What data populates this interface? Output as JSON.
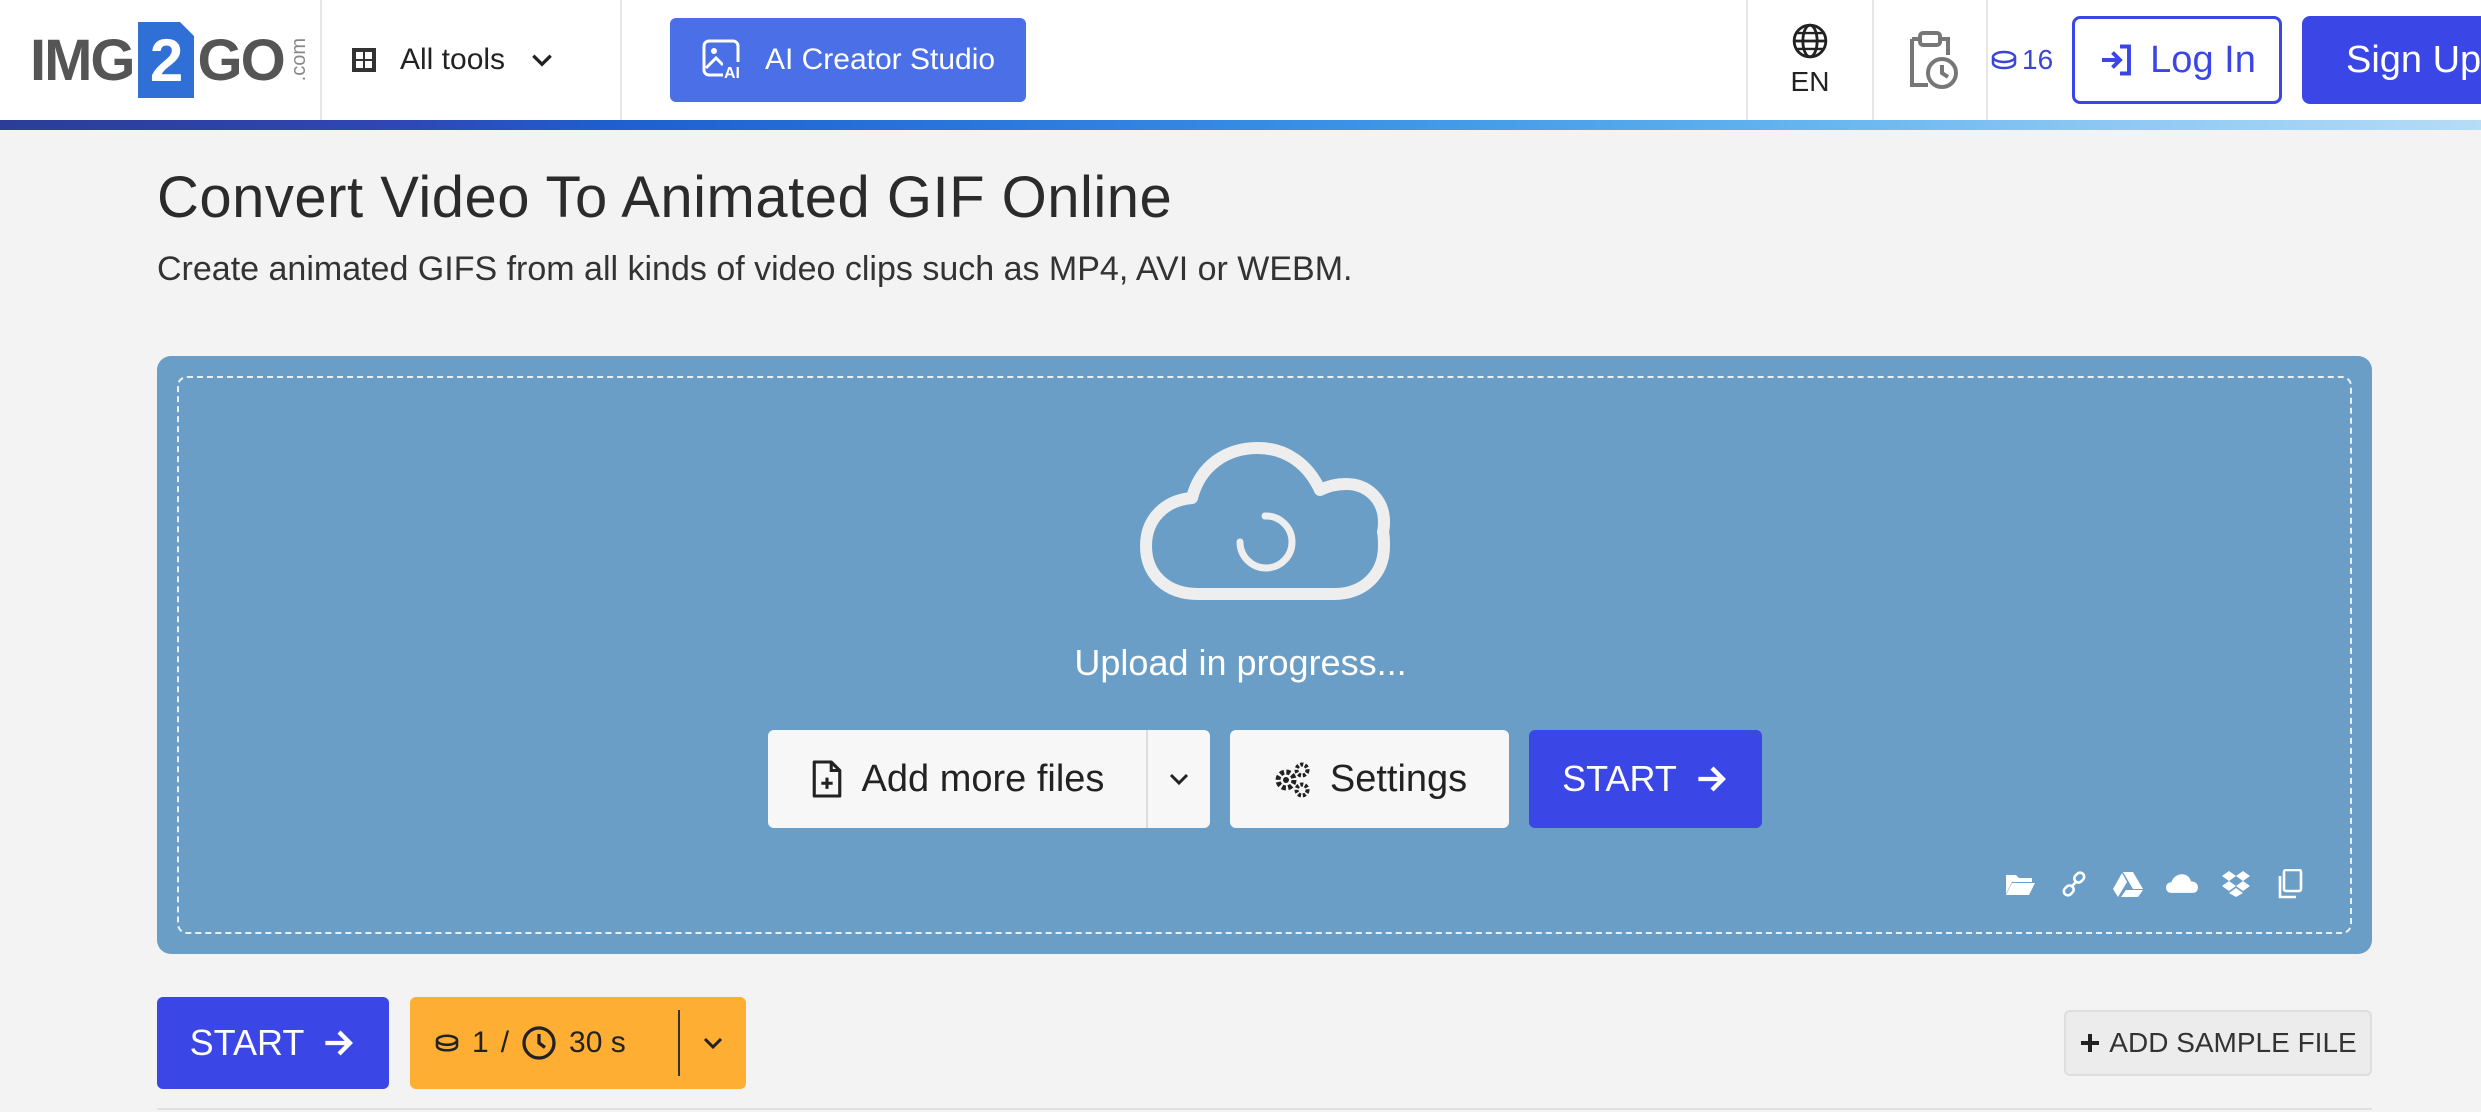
{
  "header": {
    "logo_left": "IMG",
    "logo_mid": "2",
    "logo_right": "GO",
    "logo_suffix": ".com",
    "all_tools_label": "All tools",
    "ai_button_label": "AI Creator Studio",
    "language": "EN",
    "credits": "16",
    "login_label": "Log In",
    "signup_label": "Sign Up"
  },
  "page": {
    "title": "Convert Video To Animated GIF Online",
    "subtitle": "Create animated GIFS from all kinds of video clips such as MP4, AVI or WEBM."
  },
  "upload": {
    "status": "Upload in progress...",
    "add_files_label": "Add more files",
    "settings_label": "Settings",
    "start_label": "START",
    "sources": [
      "folder-icon",
      "link-icon",
      "google-drive-icon",
      "onedrive-icon",
      "dropbox-icon",
      "clipboard-icon"
    ]
  },
  "bottom": {
    "start_label": "START",
    "credits_cost": "1",
    "separator": "/",
    "time": "30 s",
    "sample_label": "ADD SAMPLE FILE"
  },
  "colors": {
    "primary": "#3b46e6",
    "upload_bg": "#6a9ec7",
    "cost_bg": "#ffae34",
    "ai_button": "#4b6fe6"
  }
}
